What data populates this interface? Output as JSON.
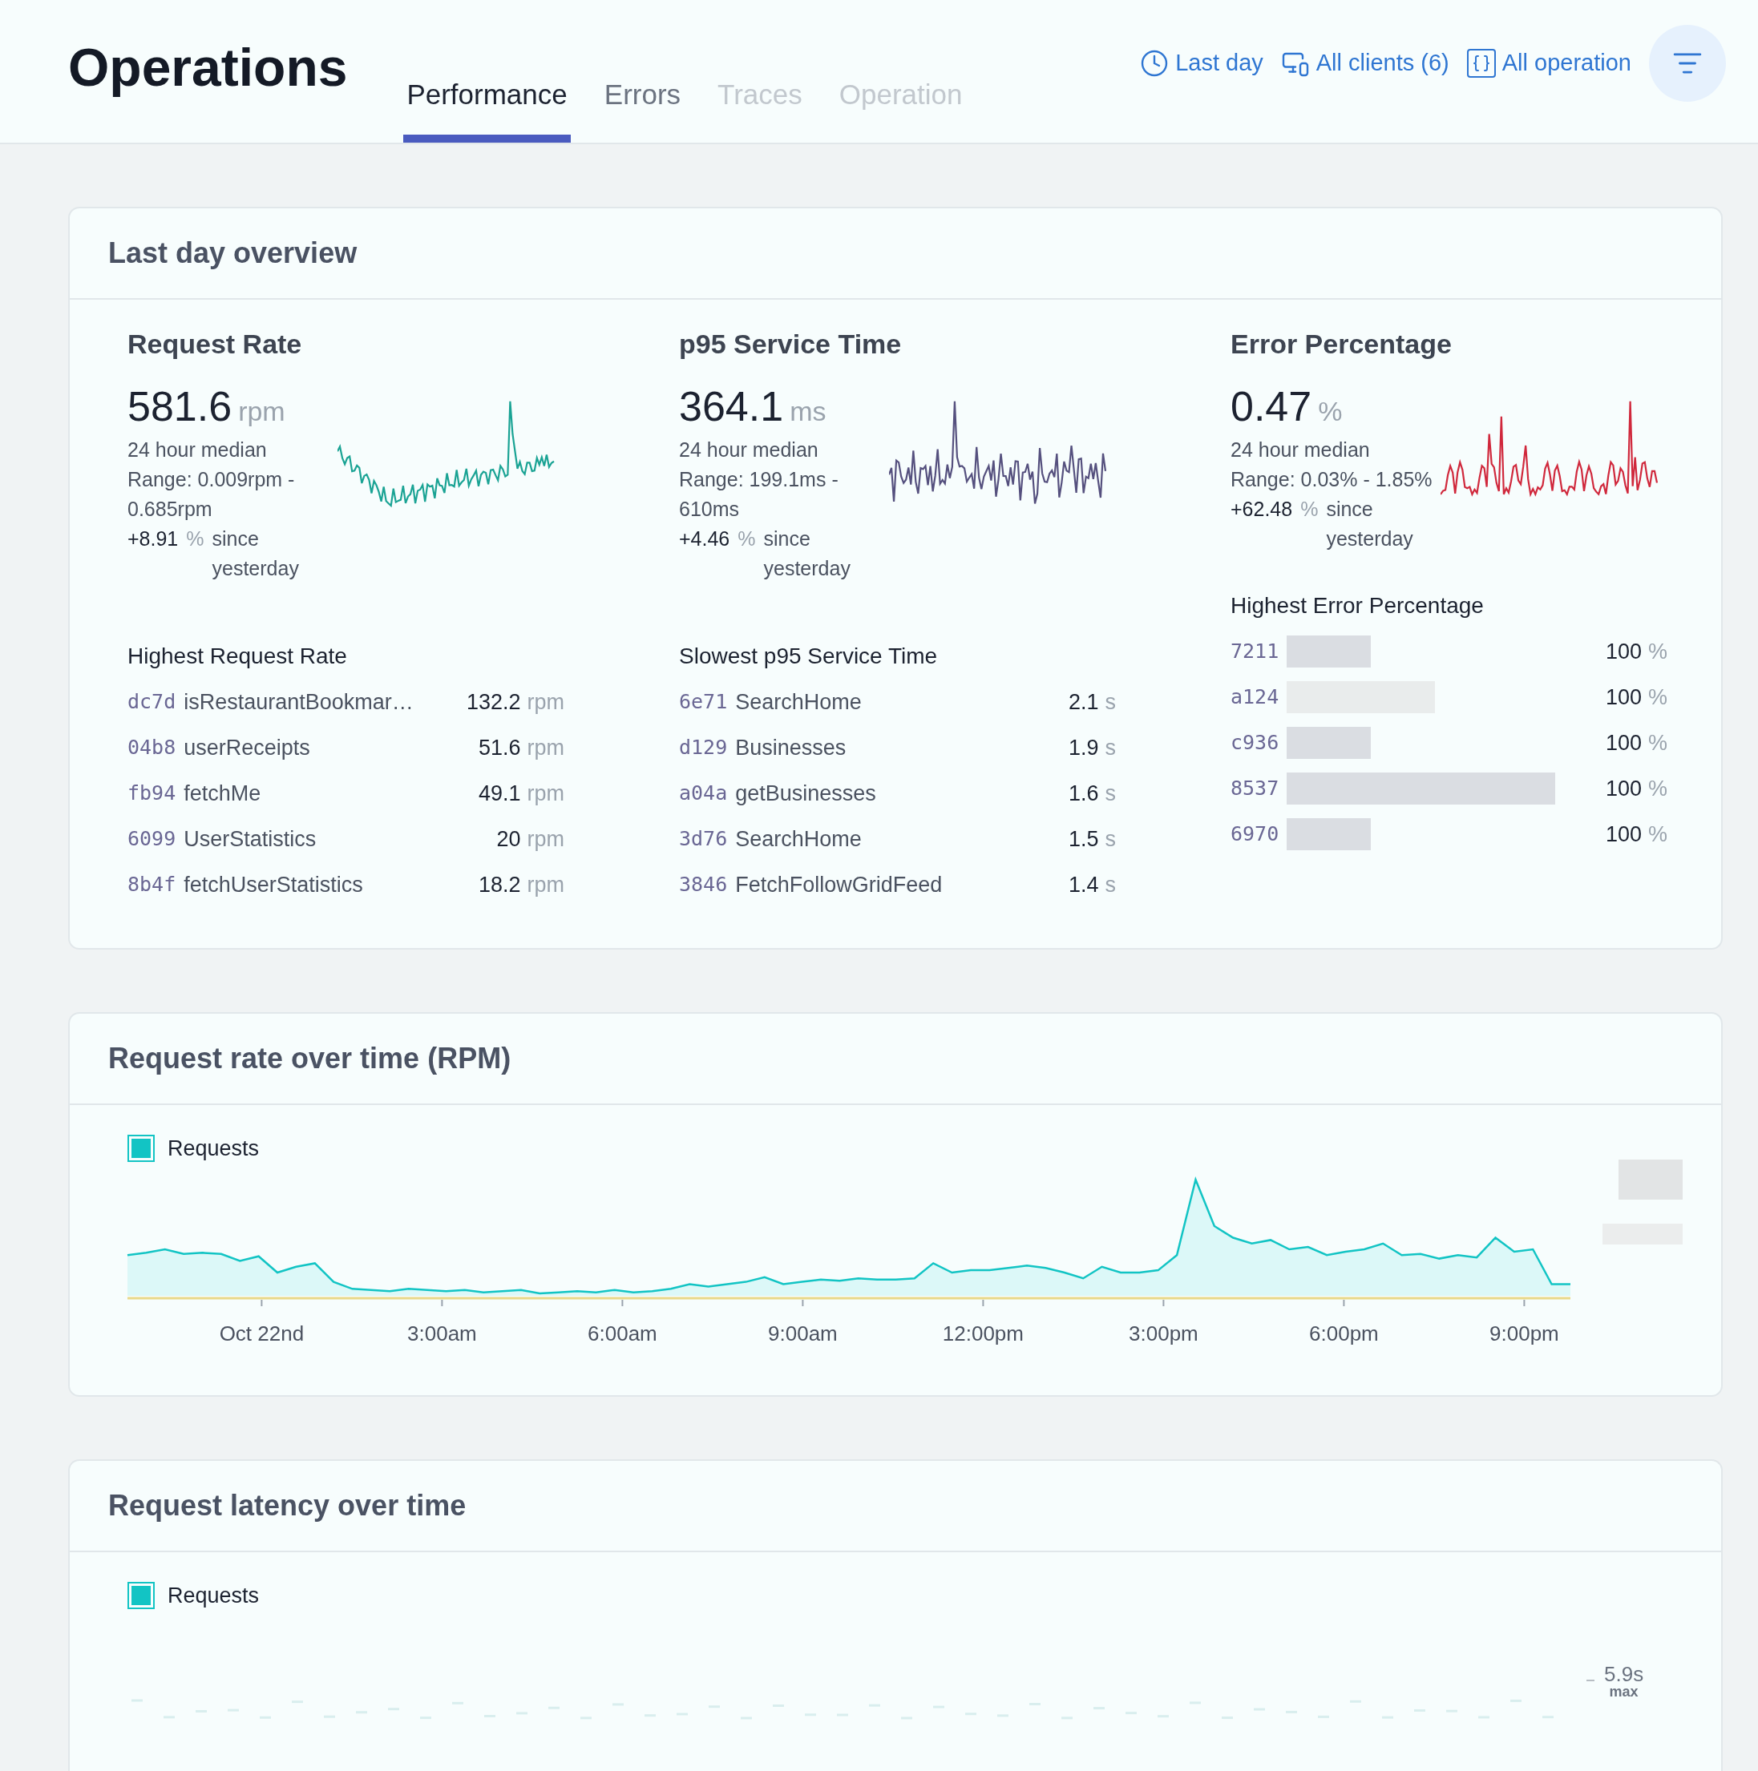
{
  "header": {
    "title": "Operations",
    "tabs": [
      {
        "label": "Performance",
        "selected": true,
        "disabled": false
      },
      {
        "label": "Errors",
        "selected": false,
        "disabled": false
      },
      {
        "label": "Traces",
        "selected": false,
        "disabled": true
      },
      {
        "label": "Operation",
        "selected": false,
        "disabled": true
      }
    ],
    "filters": [
      {
        "kind": "time",
        "label": "Last day"
      },
      {
        "kind": "clients",
        "label": "All clients (6)"
      },
      {
        "kind": "operations",
        "label": "All operation"
      }
    ]
  },
  "overview": {
    "title": "Last day overview",
    "metrics": [
      {
        "kind": "rate",
        "title": "Request Rate",
        "value": "581.6",
        "unit": "rpm",
        "caption": "24 hour median",
        "range": "Range: 0.009rpm - 0.685rpm",
        "change": "+8.91",
        "change_unit": "%",
        "since": "since yesterday",
        "color": "#1aa394",
        "list_title": "Highest Request Rate",
        "rows": [
          {
            "kind": "named",
            "id": "dc7d",
            "name": "isRestaurantBookmar…",
            "value": "132.2",
            "unit": "rpm"
          },
          {
            "kind": "named",
            "id": "04b8",
            "name": "userReceipts",
            "value": "51.6",
            "unit": "rpm"
          },
          {
            "kind": "named",
            "id": "fb94",
            "name": "fetchMe",
            "value": "49.1",
            "unit": "rpm"
          },
          {
            "kind": "named",
            "id": "6099",
            "name": "UserStatistics",
            "value": "20",
            "unit": "rpm"
          },
          {
            "kind": "named",
            "id": "8b4f",
            "name": "fetchUserStatistics",
            "value": "18.2",
            "unit": "rpm"
          }
        ]
      },
      {
        "kind": "latency",
        "title": "p95 Service Time",
        "value": "364.1",
        "unit": "ms",
        "caption": "24 hour median",
        "range": "Range: 199.1ms - 610ms",
        "change": "+4.46",
        "change_unit": "%",
        "since": "since yesterday",
        "color": "#55507e",
        "list_title": "Slowest p95 Service Time",
        "rows": [
          {
            "kind": "named",
            "id": "6e71",
            "name": "SearchHome",
            "value": "2.1",
            "unit": "s"
          },
          {
            "kind": "named",
            "id": "d129",
            "name": "Businesses",
            "value": "1.9",
            "unit": "s"
          },
          {
            "kind": "named",
            "id": "a04a",
            "name": "getBusinesses",
            "value": "1.6",
            "unit": "s"
          },
          {
            "kind": "named",
            "id": "3d76",
            "name": "SearchHome",
            "value": "1.5",
            "unit": "s"
          },
          {
            "kind": "named",
            "id": "3846",
            "name": "FetchFollowGridFeed",
            "value": "1.4",
            "unit": "s"
          }
        ]
      },
      {
        "kind": "errors",
        "title": "Error Percentage",
        "value": "0.47",
        "unit": "%",
        "caption": "24 hour median",
        "range": "Range: 0.03% - 1.85%",
        "change": "+62.48",
        "change_unit": "%",
        "since": "since yesterday",
        "color": "#d0283c",
        "list_title": "Highest Error Percentage",
        "rows": [
          {
            "kind": "redacted",
            "id": "7211",
            "value": "100",
            "unit": "%"
          },
          {
            "kind": "redacted",
            "id": "a124",
            "value": "100",
            "unit": "%"
          },
          {
            "kind": "redacted",
            "id": "c936",
            "value": "100",
            "unit": "%"
          },
          {
            "kind": "redacted",
            "id": "8537",
            "value": "100",
            "unit": "%"
          },
          {
            "kind": "redacted",
            "id": "6970",
            "value": "100",
            "unit": "%"
          }
        ]
      }
    ]
  },
  "rate_chart": {
    "title": "Request rate over time (RPM)",
    "legend": "Requests",
    "xticks": [
      "Oct 22nd",
      "3:00am",
      "6:00am",
      "9:00am",
      "12:00pm",
      "3:00pm",
      "6:00pm",
      "9:00pm"
    ]
  },
  "latency_chart": {
    "title": "Request latency over time",
    "legend": "Requests",
    "max_value": "5.9s",
    "max_label": "max"
  }
}
